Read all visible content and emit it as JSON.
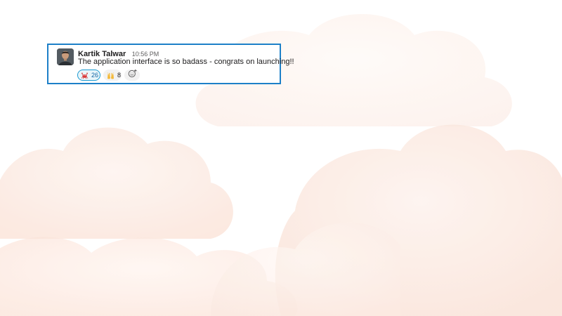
{
  "message": {
    "author": "Kartik Talwar",
    "timestamp": "10:56 PM",
    "text": "The application interface is so badass - congrats on launching!!",
    "avatar_icon": "user-avatar-photo"
  },
  "reactions": [
    {
      "emoji": "crab-icon",
      "count": "26",
      "selected": true
    },
    {
      "emoji": "raised-hands-icon",
      "count": "8",
      "selected": false
    }
  ],
  "add_reaction_icon": "add-reaction-icon",
  "colors": {
    "focus_border": "#1d80c8",
    "reaction_selected_bg": "#e8f5fa",
    "reaction_selected_border": "#1d9bd1",
    "cloud_tint": "#fbe6dc"
  }
}
